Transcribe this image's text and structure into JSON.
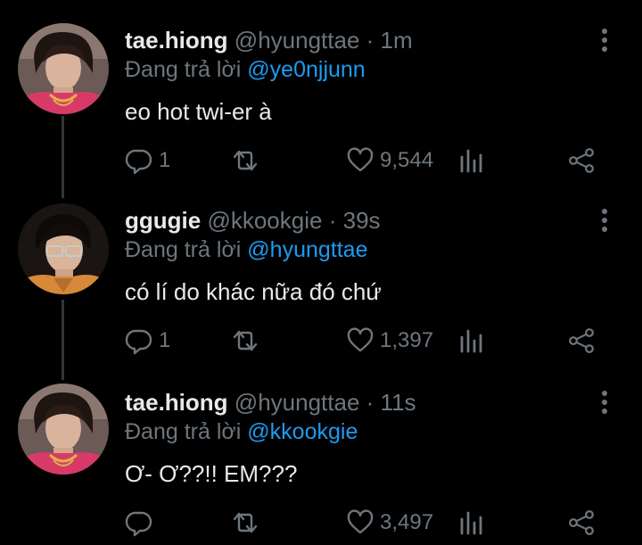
{
  "tweets": [
    {
      "name": "tae.hiong",
      "handle": "@hyungttae",
      "separator": "·",
      "time": "1m",
      "reply_prefix": "Đang trả lời",
      "reply_to": "@ye0njjunn",
      "text": "eo hot twi-er à",
      "replies": "1",
      "retweets": "",
      "likes": "9,544"
    },
    {
      "name": "ggugie",
      "handle": "@kkookgie",
      "separator": "·",
      "time": "39s",
      "reply_prefix": "Đang trả lời",
      "reply_to": "@hyungttae",
      "text": "có lí do khác nữa đó chứ",
      "replies": "1",
      "retweets": "",
      "likes": "1,397"
    },
    {
      "name": "tae.hiong",
      "handle": "@hyungttae",
      "separator": "·",
      "time": "11s",
      "reply_prefix": "Đang trả lời",
      "reply_to": "@kkookgie",
      "text": "Ơ- Ơ??!! EM???",
      "replies": "",
      "retweets": "",
      "likes": "3,497"
    }
  ],
  "colors": {
    "background": "#000000",
    "text": "#e7e9ea",
    "muted": "#6e767d",
    "mention": "#1d9bf0",
    "thread_line": "#333639"
  },
  "icons": [
    "reply-icon",
    "retweet-icon",
    "like-icon",
    "stats-icon",
    "share-icon",
    "more-icon"
  ]
}
